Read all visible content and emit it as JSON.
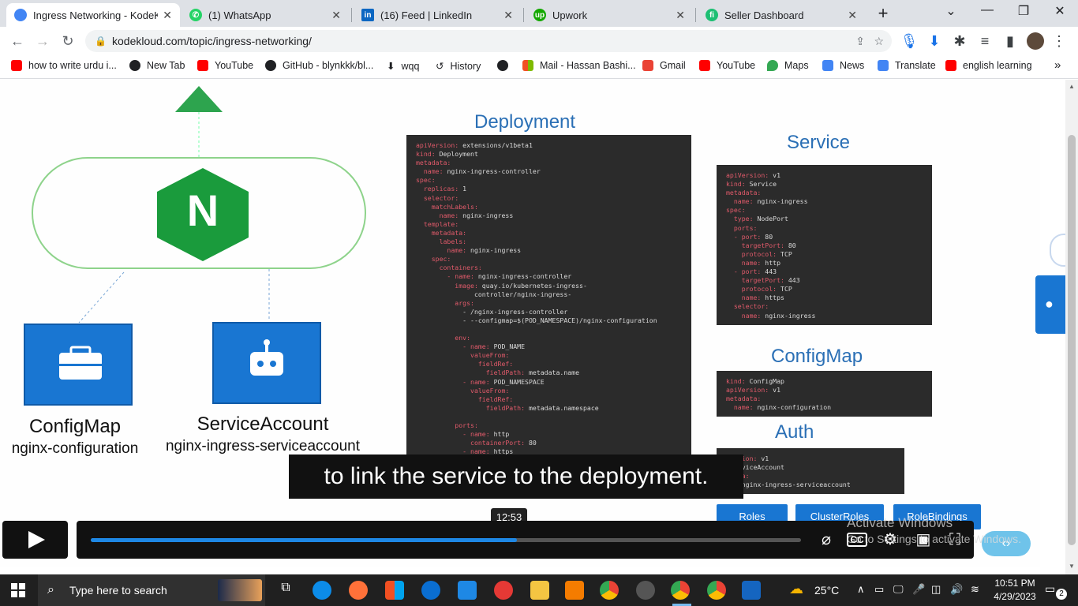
{
  "browser": {
    "tabs": [
      {
        "label": "Ingress Networking - KodeKl",
        "active": true,
        "icon": "kodekloud-icon",
        "color": "#4285f4"
      },
      {
        "label": "(1) WhatsApp",
        "active": false,
        "icon": "whatsapp-icon",
        "color": "#25d366"
      },
      {
        "label": "(16) Feed | LinkedIn",
        "active": false,
        "icon": "linkedin-icon",
        "color": "#0a66c2"
      },
      {
        "label": "Upwork",
        "active": false,
        "icon": "upwork-icon",
        "color": "#14a800"
      },
      {
        "label": "Seller Dashboard",
        "active": false,
        "icon": "fiverr-icon",
        "color": "#1dbf73"
      }
    ],
    "url": "kodekloud.com/topic/ingress-networking/",
    "bookmarks": [
      {
        "label": "how to write urdu i...",
        "icon": "youtube-icon",
        "color": "#ff0000"
      },
      {
        "label": "New Tab",
        "icon": "globe-icon",
        "color": "#202124"
      },
      {
        "label": "YouTube",
        "icon": "youtube-icon",
        "color": "#ff0000"
      },
      {
        "label": "GitHub - blynkkk/bl...",
        "icon": "github-icon",
        "color": "#202124"
      },
      {
        "label": "wqq",
        "icon": "download-icon",
        "color": "#202124"
      },
      {
        "label": "History",
        "icon": "history-icon",
        "color": "#202124"
      },
      {
        "label": "",
        "icon": "globe-icon",
        "color": "#202124"
      },
      {
        "label": "Mail - Hassan Bashi...",
        "icon": "microsoft-icon",
        "color": "#f25022"
      },
      {
        "label": "Gmail",
        "icon": "gmail-icon",
        "color": "#ea4335"
      },
      {
        "label": "YouTube",
        "icon": "youtube-icon",
        "color": "#ff0000"
      },
      {
        "label": "Maps",
        "icon": "maps-icon",
        "color": "#34a853"
      },
      {
        "label": "News",
        "icon": "news-icon",
        "color": "#4285f4"
      },
      {
        "label": "Translate",
        "icon": "translate-icon",
        "color": "#4285f4"
      },
      {
        "label": "english learning",
        "icon": "youtube-icon",
        "color": "#ff0000"
      }
    ]
  },
  "slide": {
    "deployment_title": "Deployment",
    "service_title": "Service",
    "configmap_title": "ConfigMap",
    "auth_title": "Auth",
    "configmap_label": "ConfigMap",
    "configmap_sub": "nginx-configuration",
    "serviceaccount_label": "ServiceAccount",
    "serviceaccount_sub": "nginx-ingress-serviceaccount",
    "nginx_letter": "N",
    "role_buttons": [
      "Roles",
      "ClusterRoles",
      "RoleBindings"
    ],
    "deployment_code": [
      [
        "apiVersion:",
        " extensions/v1beta1"
      ],
      [
        "kind:",
        " Deployment"
      ],
      [
        "metadata:",
        ""
      ],
      [
        "  name:",
        " nginx-ingress-controller"
      ],
      [
        "spec:",
        ""
      ],
      [
        "  replicas:",
        " 1"
      ],
      [
        "  selector:",
        ""
      ],
      [
        "    matchLabels:",
        ""
      ],
      [
        "      name:",
        " nginx-ingress"
      ],
      [
        "  template:",
        ""
      ],
      [
        "    metadata:",
        ""
      ],
      [
        "      labels:",
        ""
      ],
      [
        "        name:",
        " nginx-ingress"
      ],
      [
        "    spec:",
        ""
      ],
      [
        "      containers:",
        ""
      ],
      [
        "        - name:",
        " nginx-ingress-controller"
      ],
      [
        "          image:",
        " quay.io/kubernetes-ingress-"
      ],
      [
        "",
        "               controller/nginx-ingress-"
      ],
      [
        "          args:",
        ""
      ],
      [
        "            ",
        "- /nginx-ingress-controller"
      ],
      [
        "            ",
        "- --configmap=$(POD_NAMESPACE)/nginx-configuration"
      ],
      [
        "",
        ""
      ],
      [
        "          env:",
        ""
      ],
      [
        "            - name:",
        " POD_NAME"
      ],
      [
        "              valueFrom:",
        ""
      ],
      [
        "                fieldRef:",
        ""
      ],
      [
        "                  fieldPath:",
        " metadata.name"
      ],
      [
        "            - name:",
        " POD_NAMESPACE"
      ],
      [
        "              valueFrom:",
        ""
      ],
      [
        "                fieldRef:",
        ""
      ],
      [
        "                  fieldPath:",
        " metadata.namespace"
      ],
      [
        "",
        ""
      ],
      [
        "          ports:",
        ""
      ],
      [
        "            - name:",
        " http"
      ],
      [
        "              containerPort:",
        " 80"
      ],
      [
        "            - name:",
        " https"
      ]
    ],
    "service_code": [
      [
        "apiVersion:",
        " v1"
      ],
      [
        "kind:",
        " Service"
      ],
      [
        "metadata:",
        ""
      ],
      [
        "  name:",
        " nginx-ingress"
      ],
      [
        "spec:",
        ""
      ],
      [
        "  type:",
        " NodePort"
      ],
      [
        "  ports:",
        ""
      ],
      [
        "  - port:",
        " 80"
      ],
      [
        "    targetPort:",
        " 80"
      ],
      [
        "    protocol:",
        " TCP"
      ],
      [
        "    name:",
        " http"
      ],
      [
        "  - port:",
        " 443"
      ],
      [
        "    targetPort:",
        " 443"
      ],
      [
        "    protocol:",
        " TCP"
      ],
      [
        "    name:",
        " https"
      ],
      [
        "  selector:",
        ""
      ],
      [
        "    name:",
        " nginx-ingress"
      ]
    ],
    "configmap_code": [
      [
        "kind:",
        " ConfigMap"
      ],
      [
        "apiVersion:",
        " v1"
      ],
      [
        "metadata:",
        ""
      ],
      [
        "  name:",
        " nginx-configuration"
      ]
    ],
    "auth_code": [
      [
        "Version:",
        " v1"
      ],
      [
        "",
        " ServiceAccount"
      ],
      [
        "adata:",
        ""
      ],
      [
        "me:",
        " nginx-ingress-serviceaccount"
      ]
    ]
  },
  "player": {
    "caption": "to link the service to the deployment.",
    "time_tooltip": "12:53",
    "progress_fraction": 0.6,
    "cc_label": "CC",
    "watermark_line1": "Activate Windows",
    "watermark_line2": "Go to Settings to activate Windows."
  },
  "taskbar": {
    "search_placeholder": "Type here to search",
    "weather": "25°C",
    "time": "10:51 PM",
    "date": "4/29/2023",
    "notification_count": "2"
  }
}
